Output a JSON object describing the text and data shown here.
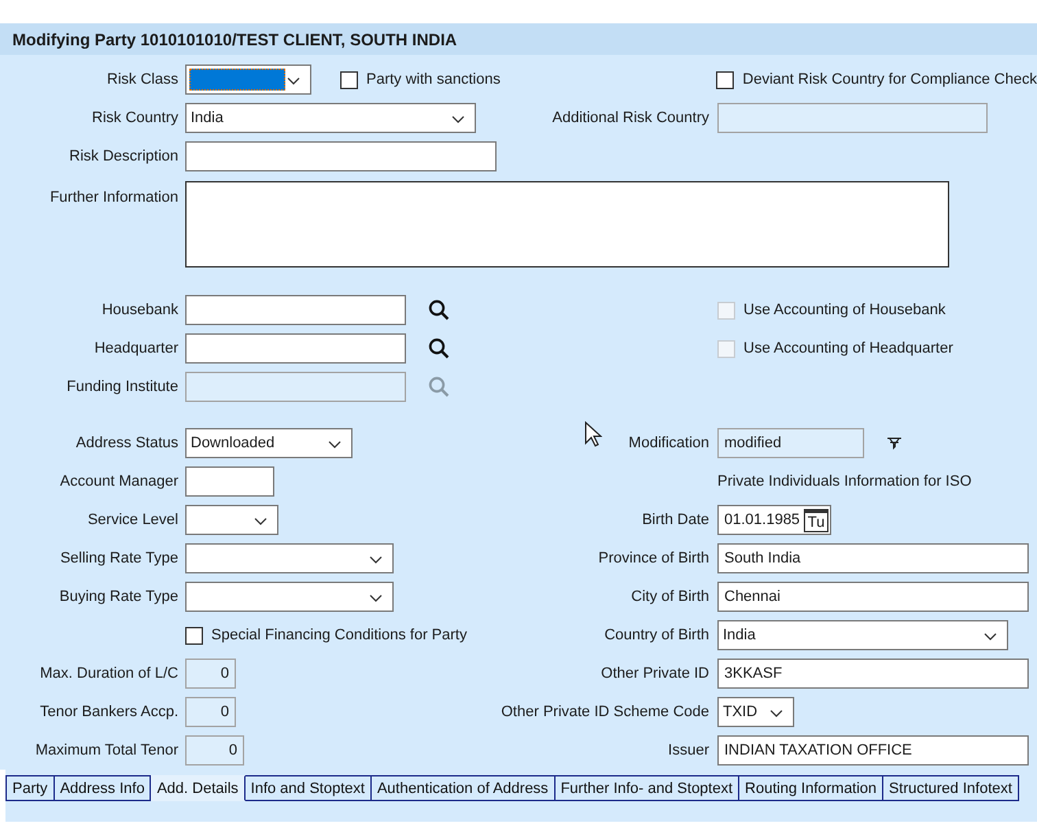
{
  "title": "Modifying Party 1010101010/TEST CLIENT, SOUTH INDIA",
  "sections": [
    {
      "rows": [
        {
          "left": [
            {
              "kind": "select",
              "label": "Risk Class",
              "focused": true,
              "disabled": false
            },
            {
              "kind": "checkbox",
              "text": "Party with sanctions",
              "checked": false,
              "disabled": false
            }
          ],
          "right": [
            {
              "kind": "checkbox",
              "text": "Deviant Risk Country for Compliance Check",
              "checked": false,
              "disabled": false
            }
          ]
        },
        {
          "left": [
            {
              "kind": "select",
              "label": "Risk Country",
              "value": "India",
              "focused": false,
              "disabled": false
            }
          ],
          "right": [
            {
              "kind": "text",
              "label": "Additional Risk Country",
              "disabled": true
            }
          ]
        },
        {
          "left": [
            {
              "kind": "text",
              "label": "Risk Description",
              "disabled": false
            }
          ]
        },
        {
          "left": [
            {
              "kind": "textarea",
              "label": "Further Information",
              "disabled": false
            }
          ]
        }
      ]
    },
    {
      "rows": [
        {
          "left": [
            {
              "kind": "lookup",
              "label": "Housebank",
              "disabled": false
            }
          ],
          "right": [
            {
              "kind": "checkbox",
              "text": "Use Accounting of Housebank",
              "checked": false,
              "disabled": true
            }
          ]
        },
        {
          "left": [
            {
              "kind": "lookup",
              "label": "Headquarter",
              "disabled": false
            }
          ],
          "right": [
            {
              "kind": "checkbox",
              "text": "Use Accounting of Headquarter",
              "checked": false,
              "disabled": true
            }
          ]
        },
        {
          "left": [
            {
              "kind": "lookup",
              "label": "Funding Institute",
              "disabled": true
            }
          ]
        }
      ]
    },
    {
      "rows": [
        {
          "left": [
            {
              "kind": "select",
              "label": "Address Status",
              "value": "Downloaded",
              "focused": false,
              "disabled": false
            }
          ],
          "right": [
            {
              "kind": "text_icon",
              "label": "Modification",
              "value": "modified",
              "disabled": true
            }
          ]
        },
        {
          "left": [
            {
              "kind": "text",
              "label": "Account Manager",
              "disabled": false
            }
          ],
          "right": [
            {
              "kind": "note",
              "text": "Private Individuals Information for ISO"
            }
          ]
        },
        {
          "left": [
            {
              "kind": "select",
              "label": "Service Level",
              "focused": false,
              "disabled": false
            }
          ],
          "right": [
            {
              "kind": "date",
              "label": "Birth Date",
              "value": "01.01.1985",
              "calendar_text": "Tu",
              "disabled": false
            }
          ]
        },
        {
          "left": [
            {
              "kind": "select",
              "label": "Selling Rate Type",
              "focused": false,
              "disabled": false
            }
          ],
          "right": [
            {
              "kind": "text",
              "label": "Province of Birth",
              "value": "South India",
              "disabled": false
            }
          ]
        },
        {
          "left": [
            {
              "kind": "select",
              "label": "Buying Rate Type",
              "focused": false,
              "disabled": false
            }
          ],
          "right": [
            {
              "kind": "text",
              "label": "City of Birth",
              "value": "Chennai",
              "disabled": false
            }
          ]
        },
        {
          "left": [
            {
              "kind": "checkbox",
              "text": "Special Financing Conditions for Party",
              "checked": false,
              "disabled": false
            }
          ],
          "right": [
            {
              "kind": "select",
              "label": "Country of Birth",
              "value": "India",
              "focused": false,
              "disabled": false
            }
          ]
        },
        {
          "left": [
            {
              "kind": "number",
              "label": "Max. Duration of L/C",
              "value": "0",
              "disabled": true
            }
          ],
          "right": [
            {
              "kind": "text",
              "label": "Other Private ID",
              "value": "3KKASF",
              "disabled": false
            }
          ]
        },
        {
          "left": [
            {
              "kind": "number",
              "label": "Tenor Bankers Accp.",
              "value": "0",
              "disabled": true
            }
          ],
          "right": [
            {
              "kind": "select",
              "label": "Other Private ID Scheme Code",
              "value": "TXID",
              "focused": false,
              "disabled": false
            }
          ]
        },
        {
          "left": [
            {
              "kind": "number",
              "label": "Maximum Total Tenor",
              "value": "0",
              "disabled": true
            }
          ],
          "right": [
            {
              "kind": "text",
              "label": "Issuer",
              "value": "INDIAN TAXATION OFFICE",
              "disabled": false
            }
          ]
        }
      ]
    }
  ],
  "tabs": [
    {
      "label": "Party",
      "selected": false
    },
    {
      "label": "Address Info",
      "selected": false
    },
    {
      "label": "Add. Details",
      "selected": true
    },
    {
      "label": "Info and Stoptext",
      "selected": false
    },
    {
      "label": "Authentication of Address",
      "selected": false
    },
    {
      "label": "Further Info- and Stoptext",
      "selected": false
    },
    {
      "label": "Routing Information",
      "selected": false
    },
    {
      "label": "Structured Infotext",
      "selected": false
    }
  ]
}
